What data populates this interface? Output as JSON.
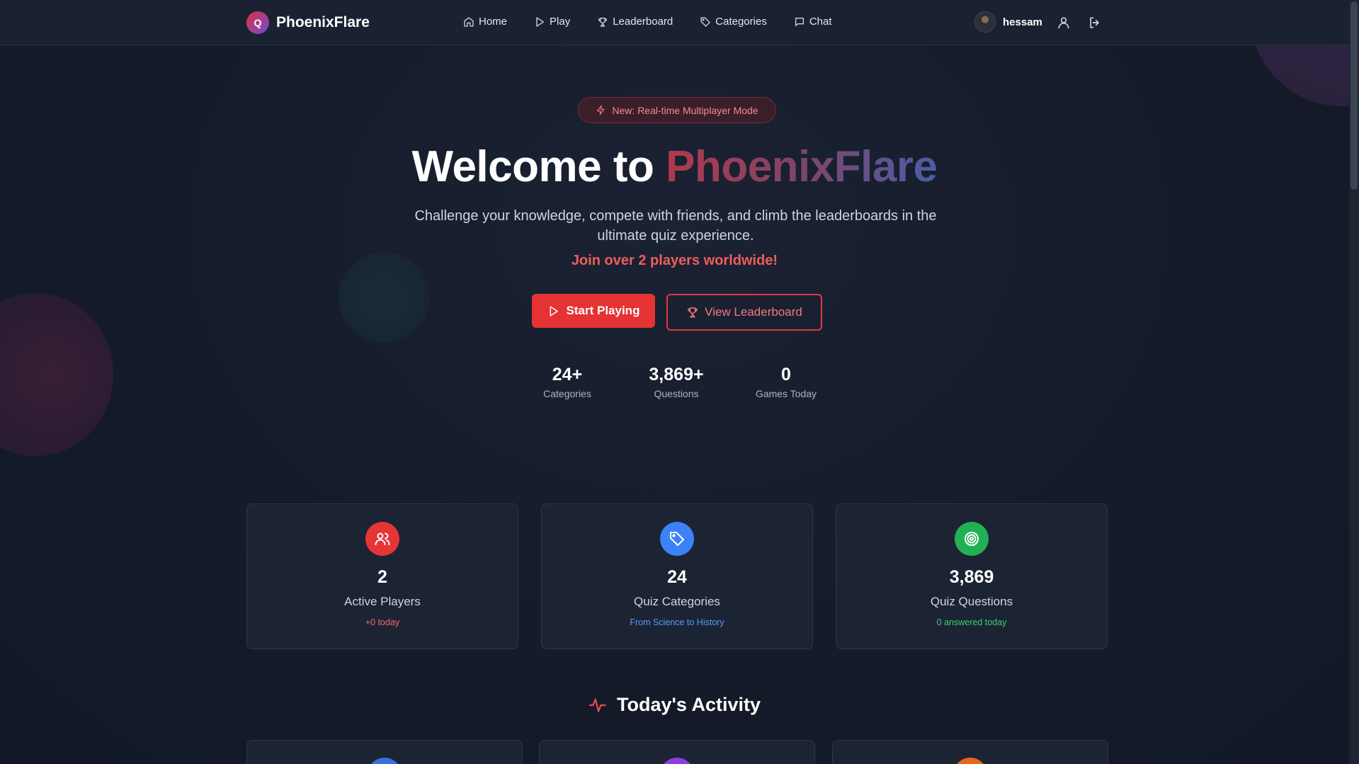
{
  "brand": {
    "logo_letter": "Q",
    "name": "PhoenixFlare"
  },
  "nav": {
    "items": [
      {
        "label": "Home",
        "icon": "home-icon"
      },
      {
        "label": "Play",
        "icon": "play-icon"
      },
      {
        "label": "Leaderboard",
        "icon": "trophy-icon"
      },
      {
        "label": "Categories",
        "icon": "tag-icon"
      },
      {
        "label": "Chat",
        "icon": "chat-icon"
      }
    ]
  },
  "user": {
    "name": "hessam"
  },
  "hero": {
    "badge": "New: Real-time Multiplayer Mode",
    "title_prefix": "Welcome to",
    "title_brand": "PhoenixFlare",
    "subtitle": "Challenge your knowledge, compete with friends, and climb the leaderboards in the ultimate quiz experience.",
    "join_text": "Join over 2 players worldwide!",
    "primary_button": "Start Playing",
    "secondary_button": "View Leaderboard"
  },
  "stats": [
    {
      "value": "24+",
      "label": "Categories"
    },
    {
      "value": "3,869+",
      "label": "Questions"
    },
    {
      "value": "0",
      "label": "Games Today"
    }
  ],
  "cards": [
    {
      "value": "2",
      "label": "Active Players",
      "sub": "+0 today",
      "icon": "users-icon",
      "color": "#e53535",
      "sub_color": "#f06a6a"
    },
    {
      "value": "24",
      "label": "Quiz Categories",
      "sub": "From Science to History",
      "icon": "tag-icon",
      "color": "#3b82f6",
      "sub_color": "#5b9cf7"
    },
    {
      "value": "3,869",
      "label": "Quiz Questions",
      "sub": "0 answered today",
      "icon": "target-icon",
      "color": "#22b055",
      "sub_color": "#3cd06f"
    }
  ],
  "activity": {
    "title": "Today's Activity",
    "icon": "activity-icon",
    "cards": [
      {
        "color": "#3b6fe0"
      },
      {
        "color": "#8b3fe0"
      },
      {
        "color": "#e8661f"
      }
    ]
  },
  "colors": {
    "accent": "#e53232",
    "background": "#111827"
  }
}
